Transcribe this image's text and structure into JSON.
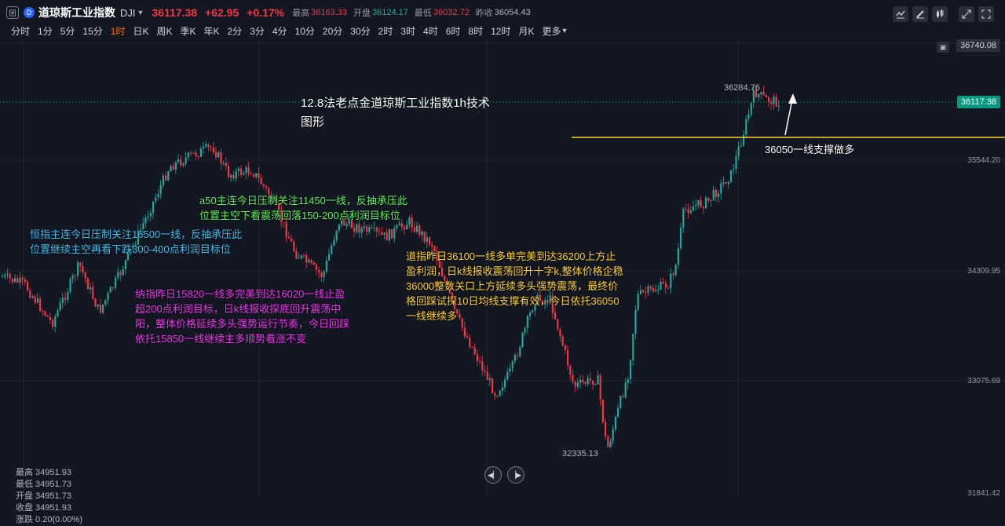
{
  "header": {
    "lock": "团",
    "logo": "D",
    "symbol_name": "道琼斯工业指数",
    "symbol_code": "DJI",
    "price": "36117.38",
    "change": "+62.95",
    "change_pct": "+0.17%",
    "high_label": "最高",
    "high": "36163.33",
    "open_label": "开盘",
    "open": "36124.17",
    "low_label": "最低",
    "low": "36032.72",
    "prev_label": "昨收",
    "prev": "36054.43"
  },
  "intervals": [
    "分时",
    "1分",
    "5分",
    "15分",
    "1时",
    "日K",
    "周K",
    "季K",
    "年K",
    "2分",
    "3分",
    "4分",
    "10分",
    "20分",
    "30分",
    "2时",
    "3时",
    "4时",
    "6时",
    "8时",
    "12时",
    "月K",
    "更多"
  ],
  "active_interval": "1时",
  "toolbar_icons": [
    "indicator-icon",
    "draw-icon",
    "candle-type-icon",
    "expand-icon",
    "fullscreen-icon"
  ],
  "price_axis": {
    "top": "36740.08",
    "current": "36117.38",
    "levels": [
      "35544.20",
      "34309.95",
      "33075.69",
      "31841.42"
    ]
  },
  "chart_marks": {
    "high_label": "36284.76",
    "low_label": "32335.13"
  },
  "annotations": {
    "title_line1": "12.8法老点金道琼斯工业指数1h技术",
    "title_line2": "图形",
    "support": "36050一线支撑做多",
    "a50_line1": "a50主连今日压制关注11450一线，反抽承压此",
    "a50_line2": "位置主空下看震荡回落150-200点利润目标位",
    "hsi_line1": "恒指主连今日压制关注16500一线，反抽承压此",
    "hsi_line2": "位置继续主空再看下跌300-400点利润目标位",
    "ndx_line1": "纳指昨日15820一线多完美到达16020一线止盈",
    "ndx_line2": "超200点利润目标，日k线报收探底回升震荡中",
    "ndx_line3": "阳，整体价格延续多头强势运行节奏，今日回踩",
    "ndx_line4": "依托15850一线继续主多顺势看涨不变",
    "dji_line1": "道指昨日36100一线多单完美到达36200上方止",
    "dji_line2": "盈利润，日k线报收震荡回升十字k,整体价格企稳",
    "dji_line3": "36000整数关口上方延续多头强势震荡，最终价",
    "dji_line4": "格回踩试探10日均线支撑有效，今日依托36050",
    "dji_line5": "一线继续多"
  },
  "ohlc_panel": {
    "high": "最高 34951.93",
    "low": "最低 34951.73",
    "open": "开盘 34951.73",
    "close": "收盘 34951.93",
    "change": "涨跌 0.20(0.00%)"
  },
  "colors": {
    "up": "#26a69a",
    "down": "#f23645",
    "support_line": "#ffd22c",
    "background": "#131722"
  }
}
